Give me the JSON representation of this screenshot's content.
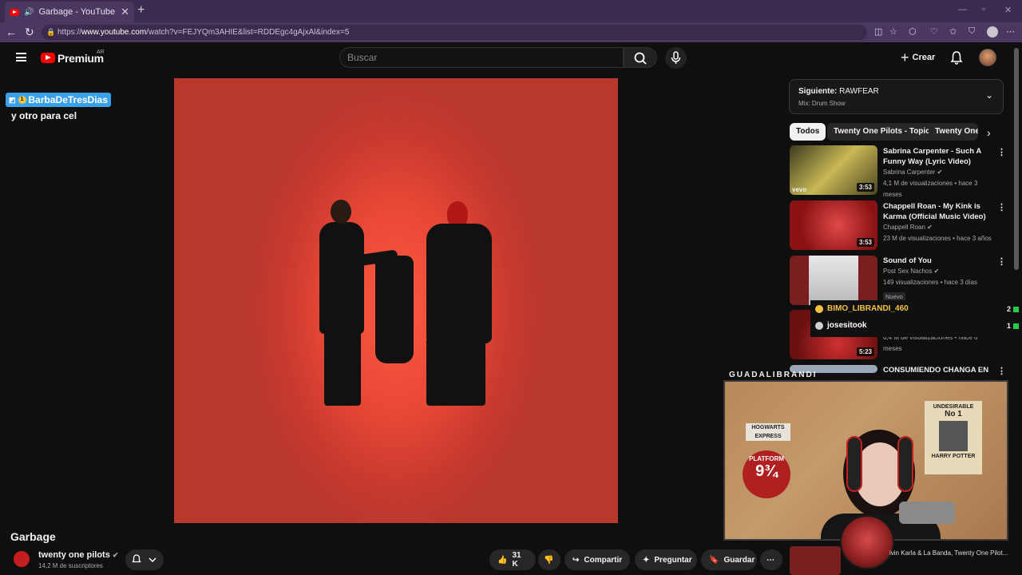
{
  "browser": {
    "tab_title": "Garbage - YouTube",
    "url_prefix": "https://",
    "url_domain": "www.youtube.com",
    "url_path": "/watch?v=FEJYQm3AHIE&list=RDDEgc4gAjxAl&index=5"
  },
  "youtube": {
    "logo_text": "Premium",
    "region": "AR",
    "search_placeholder": "Buscar",
    "create_label": "Crear"
  },
  "overlay_chat": {
    "username": "BarbaDeTresDias",
    "message": "y otro para cel"
  },
  "video": {
    "title": "Garbage",
    "channel": "twenty one pilots",
    "subscribers": "14,2 M de suscriptores",
    "likes": "31 K",
    "share_label": "Compartir",
    "ask_label": "Preguntar",
    "save_label": "Guardar"
  },
  "up_next": {
    "label": "Siguiente:",
    "title": "RAWFEAR",
    "mix": "Mix: Drum Show"
  },
  "chips": [
    "Todos",
    "Twenty One Pilots - Topic",
    "Twenty One"
  ],
  "recommendations": [
    {
      "title": "Sabrina Carpenter - Such A Funny Way (Lyric Video)",
      "channel": "Sabrina Carpenter",
      "meta": "4,1 M de visualizaciones • hace 3 meses",
      "duration": "3:53",
      "badge": "vevo"
    },
    {
      "title": "Chappell Roan - My Kink is Karma (Official Music Video)",
      "channel": "Chappell Roan",
      "meta": "23 M de visualizaciones • hace 3 años",
      "duration": "3:53"
    },
    {
      "title": "Sound of You",
      "channel": "Post Sex Nachos",
      "meta": "149 visualizaciones • hace 3 días",
      "tag": "Nuevo"
    },
    {
      "title": "",
      "channel": "",
      "meta": "6,4 M de visualizaciones • hace 6 meses",
      "duration": "5:23"
    },
    {
      "title": "CONSUMIENDO CHANGA EN",
      "channel": "",
      "meta": ""
    }
  ],
  "gift_overlay": [
    {
      "name": "BIMO_LIBRANDI_460",
      "count": "2",
      "color": "#f5c242"
    },
    {
      "name": "josesitook",
      "count": "1",
      "color": "#ffffff"
    }
  ],
  "webcam": {
    "label": "GUADALIBRANDI",
    "poster_platform": "PLATFORM",
    "poster_number": "9¾",
    "poster_undesirable": "UNDESIRABLE",
    "poster_no": "No 1",
    "poster_name": "HARRY POTTER",
    "sign_hogwarts": "HOGWARTS EXPRESS"
  },
  "bottom_rec_text": "ivin Karla & La Banda, Twenty One Pilot..."
}
